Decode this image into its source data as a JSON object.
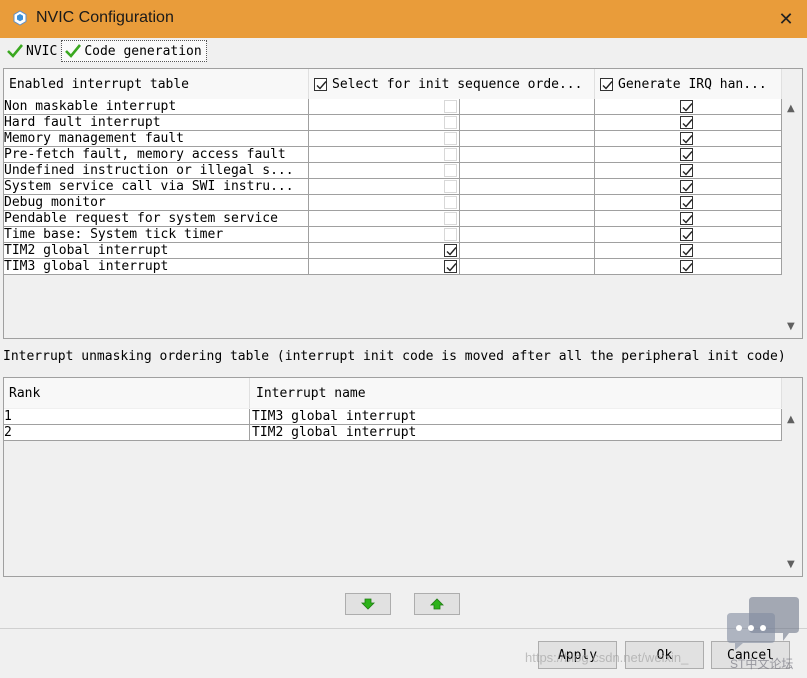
{
  "window": {
    "title": "NVIC Configuration",
    "close_glyph": "✕",
    "icon": "cube-icon"
  },
  "tabs": [
    {
      "label": "NVIC",
      "icon": "green-check-icon"
    },
    {
      "label": "Code generation",
      "icon": "green-check-icon"
    }
  ],
  "interrupt_table": {
    "headers": {
      "name": "Enabled interrupt table",
      "init_sequence": "Select for init sequence orde...",
      "irq_handler": "Generate IRQ han..."
    },
    "header_checks": {
      "init_sequence": true,
      "irq_handler": true
    },
    "rows": [
      {
        "name": "Non maskable interrupt",
        "init_sequence": null,
        "irq_handler": true
      },
      {
        "name": "Hard fault interrupt",
        "init_sequence": null,
        "irq_handler": true
      },
      {
        "name": "Memory management fault",
        "init_sequence": null,
        "irq_handler": true
      },
      {
        "name": "Pre-fetch fault, memory access fault",
        "init_sequence": null,
        "irq_handler": true
      },
      {
        "name": "Undefined instruction or illegal s...",
        "init_sequence": null,
        "irq_handler": true
      },
      {
        "name": "System service call via SWI instru...",
        "init_sequence": null,
        "irq_handler": true
      },
      {
        "name": "Debug monitor",
        "init_sequence": null,
        "irq_handler": true
      },
      {
        "name": "Pendable request for system service",
        "init_sequence": null,
        "irq_handler": true
      },
      {
        "name": "Time base: System tick timer",
        "init_sequence": null,
        "irq_handler": true
      },
      {
        "name": "TIM2 global interrupt",
        "init_sequence": true,
        "irq_handler": true
      },
      {
        "name": "TIM3 global interrupt",
        "init_sequence": true,
        "irq_handler": true
      }
    ]
  },
  "ordering": {
    "label": "Interrupt unmasking ordering table (interrupt init code is moved after all the peripheral init code)",
    "headers": {
      "rank": "Rank",
      "name": "Interrupt name"
    },
    "rows": [
      {
        "rank": "1",
        "name": "TIM3 global interrupt"
      },
      {
        "rank": "2",
        "name": "TIM2 global interrupt"
      }
    ]
  },
  "move_buttons": {
    "down_icon": "green-arrow-down-icon",
    "up_icon": "green-arrow-up-icon"
  },
  "footer": {
    "apply": "Apply",
    "ok": "Ok",
    "cancel": "Cancel"
  },
  "watermark": {
    "url": "https://blog.csdn.net/weixin_",
    "logo_text": "ST中文论坛"
  },
  "colors": {
    "titlebar": "#e99c3a",
    "check_green": "#3aa820",
    "arrow_green": "#2db31a"
  }
}
